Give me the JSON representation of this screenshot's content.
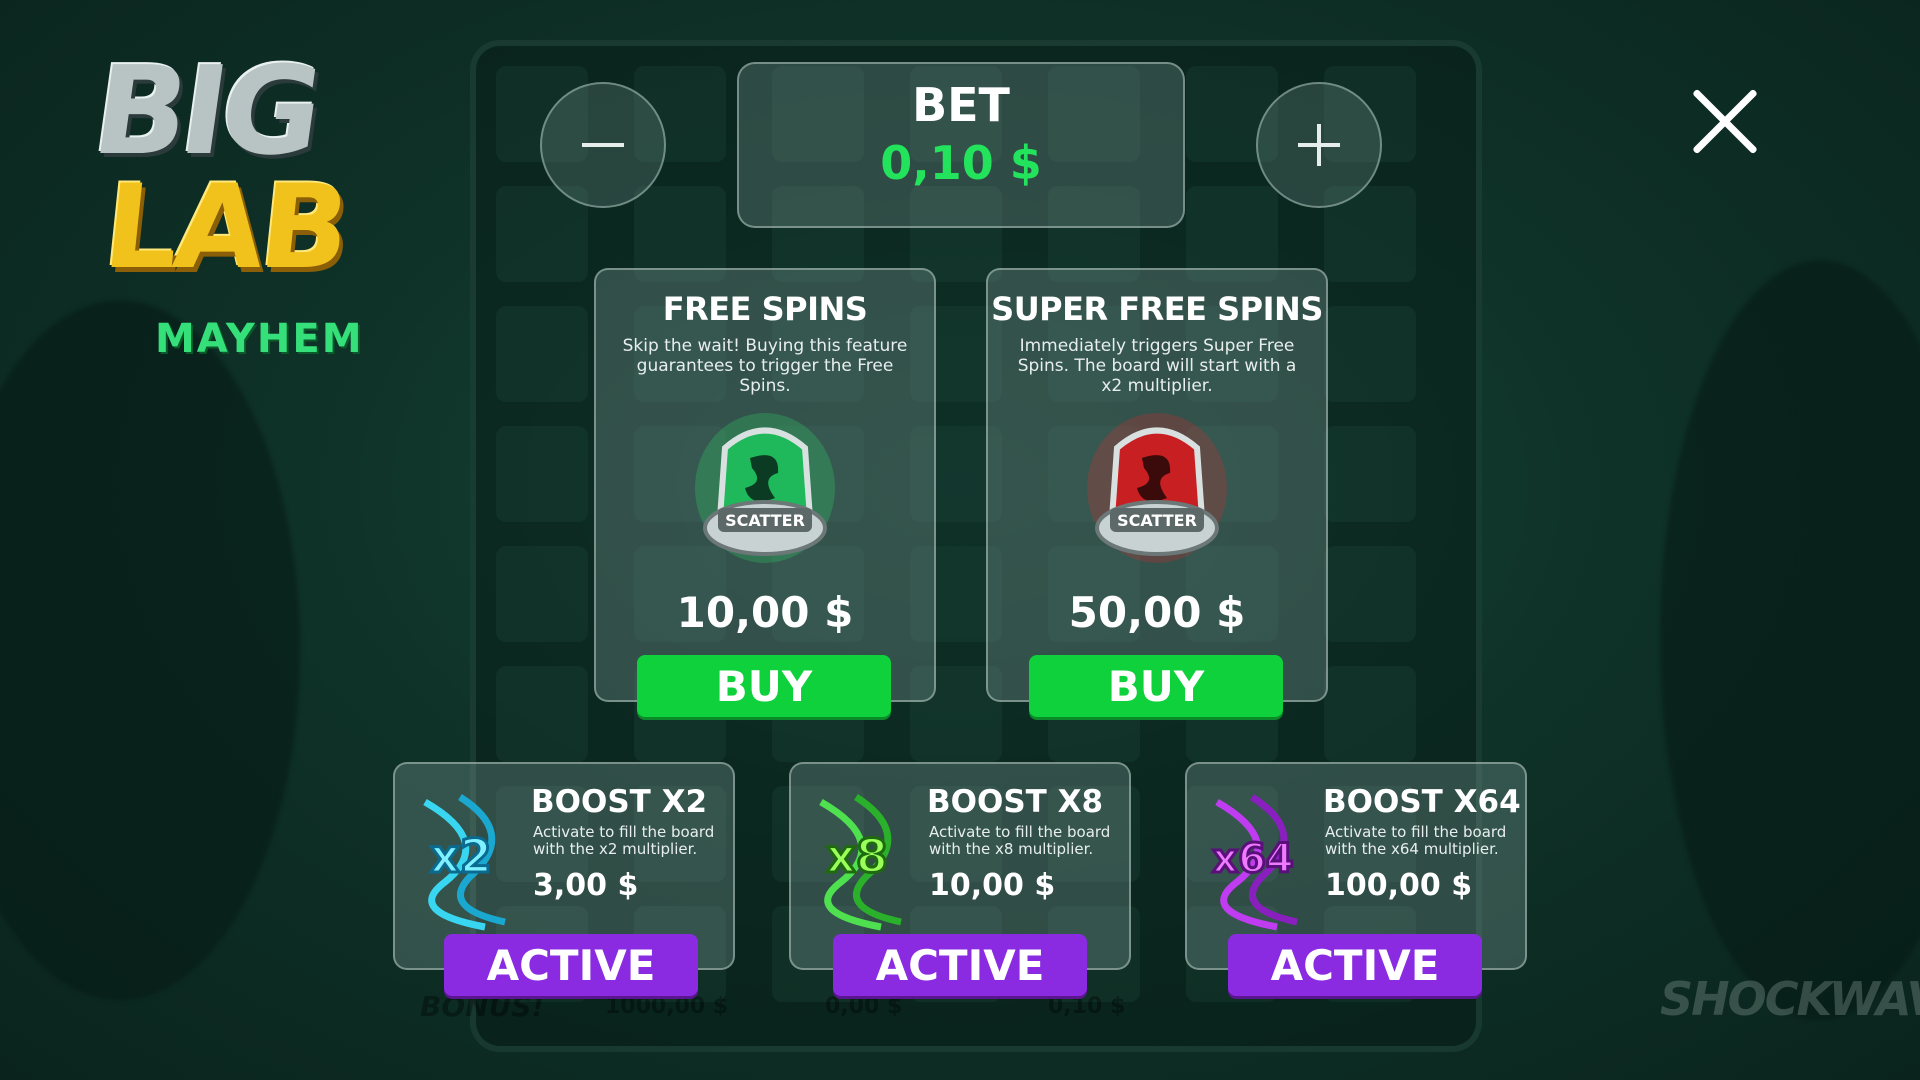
{
  "logo": {
    "line1": "BIG",
    "line2": "LAB",
    "line3": "MAYHEM"
  },
  "bet": {
    "label": "BET",
    "value": "0,10 $",
    "minus_icon": "minus-icon",
    "plus_icon": "plus-icon"
  },
  "close_icon": "close-icon",
  "features": [
    {
      "title": "FREE SPINS",
      "description": "Skip the wait! Buying this feature guarantees to trigger the Free Spins.",
      "price": "10,00 $",
      "button": "BUY",
      "icon_label": "SCATTER",
      "color": "#2ee06a"
    },
    {
      "title": "SUPER FREE SPINS",
      "description": "Immediately triggers Super Free Spins. The board will start with a x2 multiplier.",
      "price": "50,00 $",
      "button": "BUY",
      "icon_label": "SCATTER",
      "color": "#e0262a"
    }
  ],
  "boosts": [
    {
      "title": "BOOST X2",
      "badge": "x2",
      "description": "Activate to fill the board with the x2 multiplier.",
      "price": "3,00 $",
      "button": "ACTIVE",
      "color": "#38d6f0"
    },
    {
      "title": "BOOST X8",
      "badge": "x8",
      "description": "Activate to fill the board with the x8 multiplier.",
      "price": "10,00 $",
      "button": "ACTIVE",
      "color": "#4fe04f"
    },
    {
      "title": "BOOST X64",
      "badge": "x64",
      "description": "Activate to fill the board with the x64 multiplier.",
      "price": "100,00 $",
      "button": "ACTIVE",
      "color": "#c03cf0"
    }
  ],
  "background_bar": {
    "bonus": "BONUS!",
    "balance": "1000,00 $",
    "win": "0,00 $",
    "bet": "0,10 $"
  },
  "brand": "SHOCKWAVE"
}
